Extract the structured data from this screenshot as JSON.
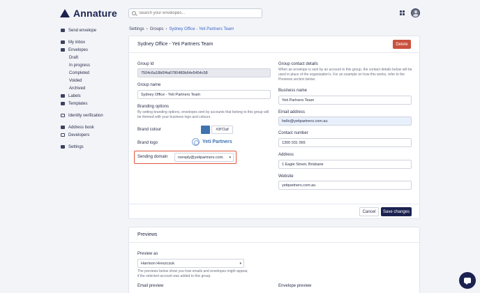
{
  "app": {
    "name": "Annature"
  },
  "search": {
    "placeholder": "Search your envelopes..."
  },
  "sidebar": {
    "items": [
      {
        "label": "Send envelope",
        "icon": "send-icon"
      },
      {
        "label": "My inbox",
        "icon": "inbox-icon"
      },
      {
        "label": "Envelopes",
        "icon": "envelope-icon"
      },
      {
        "label": "Draft"
      },
      {
        "label": "In progress"
      },
      {
        "label": "Completed"
      },
      {
        "label": "Voided"
      },
      {
        "label": "Archived"
      },
      {
        "label": "Labels",
        "icon": "tag-icon"
      },
      {
        "label": "Templates",
        "icon": "template-icon"
      },
      {
        "label": "Identity verification",
        "icon": "fingerprint-icon"
      },
      {
        "label": "Address book",
        "icon": "addressbook-icon"
      },
      {
        "label": "Developers",
        "icon": "code-icon"
      },
      {
        "label": "Settings",
        "icon": "gear-icon"
      }
    ]
  },
  "breadcrumb": {
    "items": [
      "Settings",
      "Groups",
      "Sydney Office - Yeti Partners Team"
    ],
    "separator": "›"
  },
  "group": {
    "title": "Sydney Office - Yeti Partners Team",
    "delete_label": "Delete",
    "id_label": "Group Id",
    "id_value": "7504c6a18b0f4a6780480b64e5454c58",
    "name_label": "Group name",
    "name_value": "Sydney Office - Yeti Partners Team",
    "branding_title": "Branding options",
    "branding_hint": "By setting branding options, envelopes sent by accounts that belong to this group will be themed with your business logo and colours.",
    "brand_colour_label": "Brand colour",
    "brand_colour_value": "#3f72af",
    "brand_logo_label": "Brand logo",
    "brand_logo_text": "Yeti Partners",
    "sending_domain_label": "Sending domain",
    "sending_domain_value": "noreply@yetipartners.com.",
    "contact_title": "Group contact details",
    "contact_hint": "When an envelope is sent by an account in this group, the contact details below will be used in place of the organisation's. For an example on how this works, refer to the Previews section below.",
    "business_name_label": "Business name",
    "business_name_value": "Yeti Partners Team",
    "email_label": "Email address",
    "email_value": "hello@yetipartners.com.au",
    "contact_number_label": "Contact number",
    "contact_number_value": "1300 031 065",
    "address_label": "Address",
    "address_value": "1 Eagle Street, Brisbane",
    "website_label": "Website",
    "website_value": "yetipartners.com.au",
    "cancel_label": "Cancel",
    "save_label": "Save changes"
  },
  "previews": {
    "title": "Previews",
    "preview_as_label": "Preview as",
    "preview_as_value": "Harrison Hreszczuk",
    "hint": "The previews below show you how emails and envelopes might appear, if the selected account was added to this group.",
    "email_preview_label": "Email preview",
    "envelope_preview_label": "Envelope preview"
  },
  "colors": {
    "brand": "#1b2250",
    "accent": "#3f72af",
    "danger": "#c9523f",
    "highlight": "#e0563d"
  }
}
